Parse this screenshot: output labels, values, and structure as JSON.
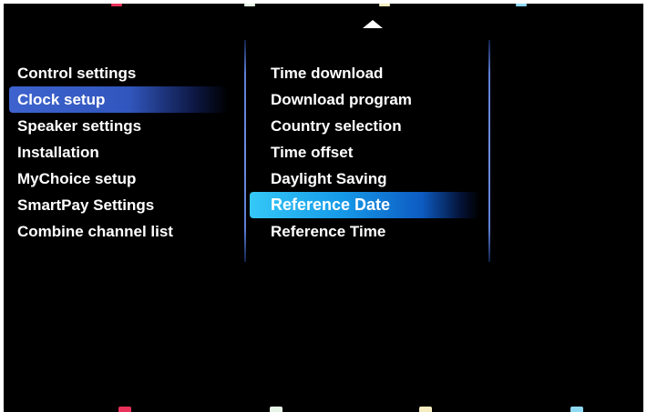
{
  "navigation": {
    "scroll_up_icon": "triangle-up"
  },
  "left_menu": {
    "items": [
      {
        "label": "Control settings",
        "selected": false
      },
      {
        "label": "Clock setup",
        "selected": true
      },
      {
        "label": "Speaker settings",
        "selected": false
      },
      {
        "label": "Installation",
        "selected": false
      },
      {
        "label": "MyChoice setup",
        "selected": false
      },
      {
        "label": "SmartPay Settings",
        "selected": false
      },
      {
        "label": "Combine channel list",
        "selected": false
      }
    ]
  },
  "sub_menu": {
    "items": [
      {
        "label": "Time download",
        "selected": false
      },
      {
        "label": "Download program",
        "selected": false
      },
      {
        "label": "Country selection",
        "selected": false
      },
      {
        "label": "Time offset",
        "selected": false
      },
      {
        "label": "Daylight Saving",
        "selected": false
      },
      {
        "label": "Reference Date",
        "selected": true
      },
      {
        "label": "Reference Time",
        "selected": false
      }
    ]
  },
  "colors": {
    "background": "#000000",
    "text": "#ffffff",
    "left_highlight": "#3e63ce",
    "sub_highlight": "#169ae8",
    "divider": "#6d8be0"
  },
  "color_keys": [
    {
      "name": "red",
      "color": "#e8315a"
    },
    {
      "name": "green",
      "color": "#e6f5e6"
    },
    {
      "name": "yellow",
      "color": "#f4ecc0"
    },
    {
      "name": "blue",
      "color": "#8ed9f2"
    }
  ]
}
